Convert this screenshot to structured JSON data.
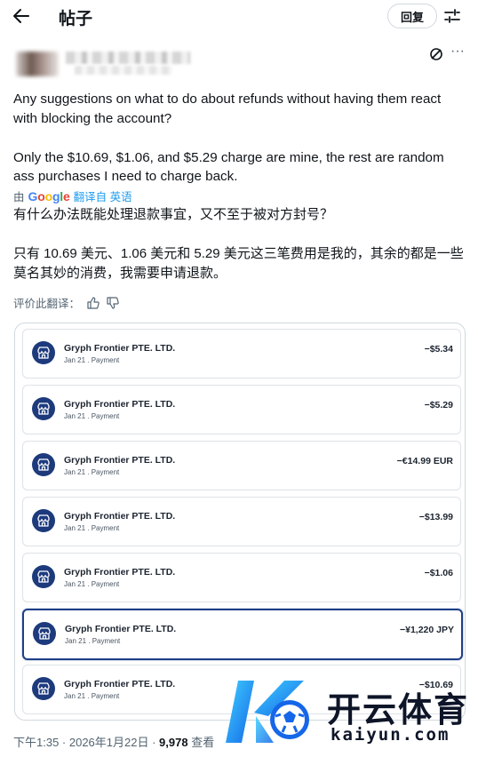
{
  "header": {
    "title": "帖子",
    "reply_label": "回复"
  },
  "post": {
    "text_paragraphs": [
      "Any suggestions on what to do about refunds without having them react with blocking the account?",
      "Only the $10.69, $1.06, and $5.29 charge are mine, the rest are random ass purchases I need to charge back."
    ],
    "translated_by_prefix": "由",
    "translated_by_brand": "Google",
    "translated_from": "翻译自 英语",
    "translated_paragraphs": [
      "有什么办法既能处理退款事宜，又不至于被对方封号？",
      "只有 10.69 美元、1.06 美元和 5.29 美元这三笔费用是我的，其余的都是一些莫名其妙的消费，我需要申请退款。"
    ],
    "rate_label": "评价此翻译："
  },
  "transactions": [
    {
      "merchant": "Gryph Frontier PTE. LTD.",
      "meta": "Jan 21 . Payment",
      "amount": "−$5.34",
      "selected": false
    },
    {
      "merchant": "Gryph Frontier PTE. LTD.",
      "meta": "Jan 21 . Payment",
      "amount": "−$5.29",
      "selected": false
    },
    {
      "merchant": "Gryph Frontier PTE. LTD.",
      "meta": "Jan 21 . Payment",
      "amount": "−€14.99 EUR",
      "selected": false
    },
    {
      "merchant": "Gryph Frontier PTE. LTD.",
      "meta": "Jan 21 . Payment",
      "amount": "−$13.99",
      "selected": false
    },
    {
      "merchant": "Gryph Frontier PTE. LTD.",
      "meta": "Jan 21 . Payment",
      "amount": "−$1.06",
      "selected": false
    },
    {
      "merchant": "Gryph Frontier PTE. LTD.",
      "meta": "Jan 21 . Payment",
      "amount": "−¥1,220 JPY",
      "selected": true
    },
    {
      "merchant": "Gryph Frontier PTE. LTD.",
      "meta": "Jan 21 . Payment",
      "amount": "−$10.69",
      "selected": false
    }
  ],
  "meta": {
    "time": "下午1:35 · 2026年1月22日 · ",
    "views_count": "9,978",
    "views_label": " 查看"
  },
  "watermark": {
    "title": "开云体育",
    "subtitle": "kaiyun.com"
  },
  "colors": {
    "accent": "#1d9bf0",
    "merchant_icon": "#1d3a7d",
    "selected_border": "#1f3f86"
  }
}
